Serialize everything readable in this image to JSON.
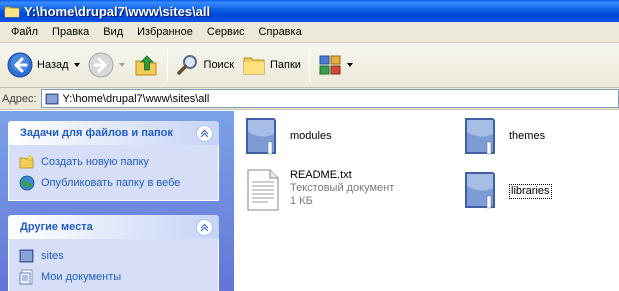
{
  "window": {
    "title": "Y:\\home\\drupal7\\www\\sites\\all"
  },
  "menu": [
    "Файл",
    "Правка",
    "Вид",
    "Избранное",
    "Сервис",
    "Справка"
  ],
  "toolbar": {
    "back_label": "Назад",
    "search_label": "Поиск",
    "folders_label": "Папки"
  },
  "address": {
    "label": "Адрес:",
    "value": "Y:\\home\\drupal7\\www\\sites\\all"
  },
  "tasks_panel": {
    "title": "Задачи для файлов и папок",
    "items": [
      {
        "label": "Создать новую папку",
        "icon": "new-folder-icon"
      },
      {
        "label": "Опубликовать папку в вебе",
        "icon": "publish-web-icon"
      }
    ]
  },
  "places_panel": {
    "title": "Другие места",
    "items": [
      {
        "label": "sites",
        "icon": "folder-icon"
      },
      {
        "label": "Мои документы",
        "icon": "my-documents-icon"
      }
    ]
  },
  "files": [
    {
      "name": "modules",
      "type": "folder"
    },
    {
      "name": "themes",
      "type": "folder"
    },
    {
      "name": "README.txt",
      "type": "text",
      "kind": "Текстовый документ",
      "size": "1 КБ"
    },
    {
      "name": "libraries",
      "type": "folder"
    }
  ],
  "colors": {
    "title_bar": "#0a5fe0",
    "task_pane": "#6f8fe0",
    "link": "#215dc6",
    "chrome": "#ece9d8"
  }
}
